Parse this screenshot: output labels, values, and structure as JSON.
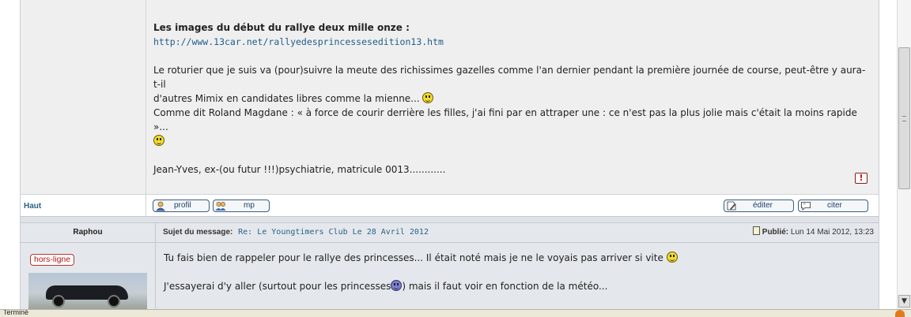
{
  "post1": {
    "heading": "Les images du début du rallye deux mille onze :",
    "link": "http://www.13car.net/rallyedesprincessesedition13.htm",
    "para1_a": "Le roturier que je suis va (pour)suivre la meute des richissimes gazelles comme l'an dernier pendant la première journée de course, peut-être y aura-t-il",
    "para1_b": "d'autres Mimix en candidates libres comme la mienne...",
    "para2": "Comme dit Roland Magdane : « à force de courir derrière les filles, j'ai fini par en attraper une : ce n'est pas la plus jolie mais c'était la moins rapide »...",
    "signature": "Jean-Yves, ex-(ou futur !!!)psychiatrie, matricule 0013............"
  },
  "toolbar": {
    "top_link": "Haut",
    "profile": "profil",
    "pm": "mp",
    "edit": "éditer",
    "quote": "citer"
  },
  "post2": {
    "author": "Raphou",
    "subject_label": "Sujet du message:",
    "subject": "Re: Le Youngtimers Club Le 28 Avril 2012",
    "posted_label": "Publié:",
    "posted_date": "Lun 14 Mai 2012, 13:23",
    "status": "hors-ligne",
    "line1": "Tu fais bien de rappeler pour le rallye des princesses... Il était noté mais je ne le voyais pas arriver si vite",
    "line2": "J'essayerai d'y aller (surtout pour les princesses",
    "line2_end": ") mais il faut voir en fonction de la météo..."
  },
  "statusbar": {
    "text": "Terminé"
  }
}
